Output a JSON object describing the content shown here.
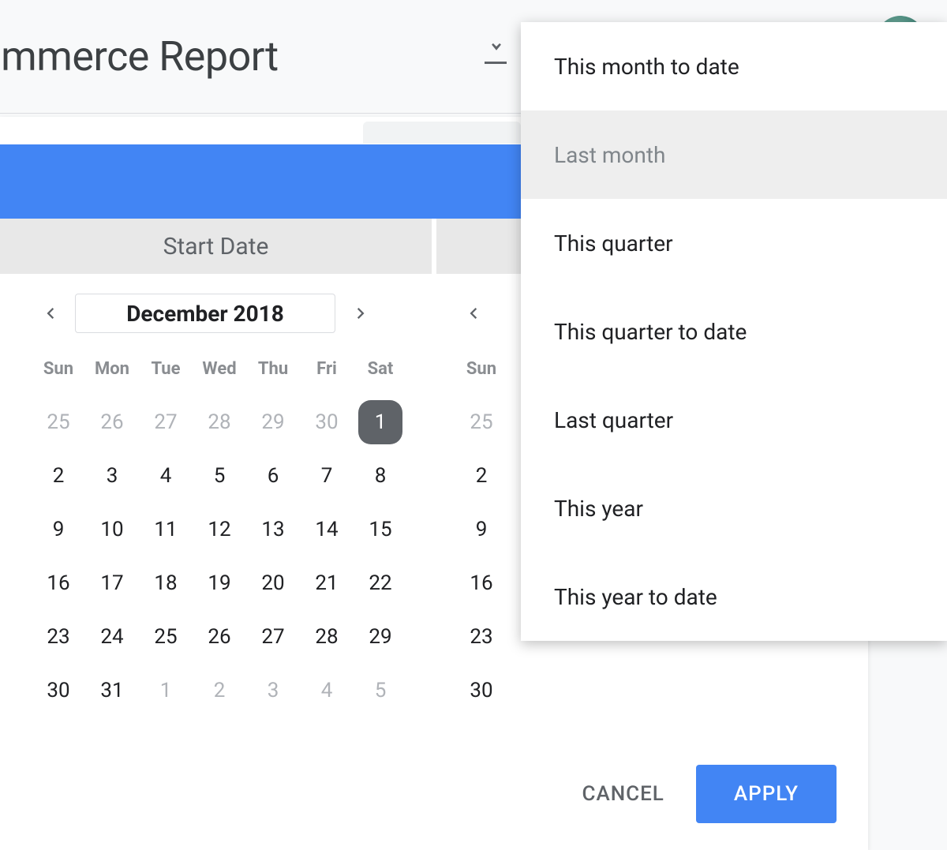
{
  "header": {
    "title": "ommerce Report"
  },
  "date_tabs": {
    "start": "Start Date"
  },
  "calendar": {
    "month_label": "December 2018",
    "day_headers": [
      "Sun",
      "Mon",
      "Tue",
      "Wed",
      "Thu",
      "Fri",
      "Sat"
    ],
    "weeks": [
      [
        {
          "d": "25",
          "m": true
        },
        {
          "d": "26",
          "m": true
        },
        {
          "d": "27",
          "m": true
        },
        {
          "d": "28",
          "m": true
        },
        {
          "d": "29",
          "m": true
        },
        {
          "d": "30",
          "m": true
        },
        {
          "d": "1",
          "sel": true
        }
      ],
      [
        {
          "d": "2"
        },
        {
          "d": "3"
        },
        {
          "d": "4"
        },
        {
          "d": "5"
        },
        {
          "d": "6"
        },
        {
          "d": "7"
        },
        {
          "d": "8"
        }
      ],
      [
        {
          "d": "9"
        },
        {
          "d": "10"
        },
        {
          "d": "11"
        },
        {
          "d": "12"
        },
        {
          "d": "13"
        },
        {
          "d": "14"
        },
        {
          "d": "15"
        }
      ],
      [
        {
          "d": "16"
        },
        {
          "d": "17"
        },
        {
          "d": "18"
        },
        {
          "d": "19"
        },
        {
          "d": "20"
        },
        {
          "d": "21"
        },
        {
          "d": "22"
        }
      ],
      [
        {
          "d": "23"
        },
        {
          "d": "24"
        },
        {
          "d": "25"
        },
        {
          "d": "26"
        },
        {
          "d": "27"
        },
        {
          "d": "28"
        },
        {
          "d": "29"
        }
      ],
      [
        {
          "d": "30"
        },
        {
          "d": "31"
        },
        {
          "d": "1",
          "m": true
        },
        {
          "d": "2",
          "m": true
        },
        {
          "d": "3",
          "m": true
        },
        {
          "d": "4",
          "m": true
        },
        {
          "d": "5",
          "m": true
        }
      ]
    ],
    "second_sun_column": [
      "Sun",
      "25",
      "2",
      "9",
      "16",
      "23",
      "30"
    ]
  },
  "presets": [
    {
      "label": "This month to date",
      "selected": false
    },
    {
      "label": "Last month",
      "selected": true
    },
    {
      "label": "This quarter",
      "selected": false
    },
    {
      "label": "This quarter to date",
      "selected": false
    },
    {
      "label": "Last quarter",
      "selected": false
    },
    {
      "label": "This year",
      "selected": false
    },
    {
      "label": "This year to date",
      "selected": false
    }
  ],
  "footer": {
    "cancel": "CANCEL",
    "apply": "APPLY"
  }
}
